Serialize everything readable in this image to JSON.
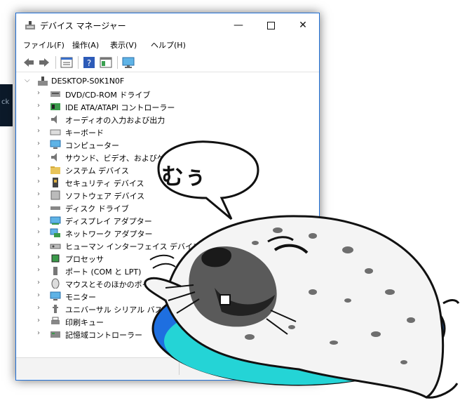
{
  "window": {
    "title": "デバイス マネージャー",
    "controls": {
      "minimize": "—",
      "maximize": "",
      "close": "✕"
    }
  },
  "menu": [
    "ファイル(F)",
    "操作(A)",
    "表示(V)",
    "ヘルプ(H)"
  ],
  "toolbar": {
    "icons": [
      "back-arrow-icon",
      "forward-arrow-icon",
      "properties-icon",
      "help-icon",
      "properties-panel-icon",
      "monitor-scan-icon"
    ]
  },
  "tree": {
    "root": "DESKTOP-S0K1N0F",
    "items": [
      {
        "label": "DVD/CD-ROM ドライブ",
        "icon": "dvd-drive-icon"
      },
      {
        "label": "IDE ATA/ATAPI コントローラー",
        "icon": "ide-controller-icon"
      },
      {
        "label": "オーディオの入力および出力",
        "icon": "speaker-icon"
      },
      {
        "label": "キーボード",
        "icon": "keyboard-icon"
      },
      {
        "label": "コンピューター",
        "icon": "computer-icon"
      },
      {
        "label": "サウンド、ビデオ、およびゲーム コントローラー",
        "icon": "sound-icon"
      },
      {
        "label": "システム デバイス",
        "icon": "system-folder-icon"
      },
      {
        "label": "セキュリティ デバイス",
        "icon": "security-key-icon"
      },
      {
        "label": "ソフトウェア デバイス",
        "icon": "software-device-icon"
      },
      {
        "label": "ディスク ドライブ",
        "icon": "disk-drive-icon"
      },
      {
        "label": "ディスプレイ アダプター",
        "icon": "display-adapter-icon"
      },
      {
        "label": "ネットワーク アダプター",
        "icon": "network-adapter-icon"
      },
      {
        "label": "ヒューマン インターフェイス デバイス",
        "icon": "hid-icon"
      },
      {
        "label": "プロセッサ",
        "icon": "processor-icon"
      },
      {
        "label": "ポート (COM と LPT)",
        "icon": "port-icon"
      },
      {
        "label": "マウスとそのほかのポインティング デバイス",
        "icon": "mouse-icon"
      },
      {
        "label": "モニター",
        "icon": "monitor-icon"
      },
      {
        "label": "ユニバーサル シリアル バス コントローラー",
        "icon": "usb-icon"
      },
      {
        "label": "印刷キュー",
        "icon": "printer-icon"
      },
      {
        "label": "記憶域コントローラー",
        "icon": "storage-controller-icon"
      }
    ]
  },
  "speech_bubble": {
    "text": "むぅ"
  },
  "bg_strip_text": "ck",
  "colors": {
    "window_border": "#1f6fd6",
    "ring_blue": "#1e6fe0",
    "ring_cyan": "#24d4d6",
    "seal_body": "#f4f4f4",
    "seal_spot": "#6e6e6e"
  }
}
